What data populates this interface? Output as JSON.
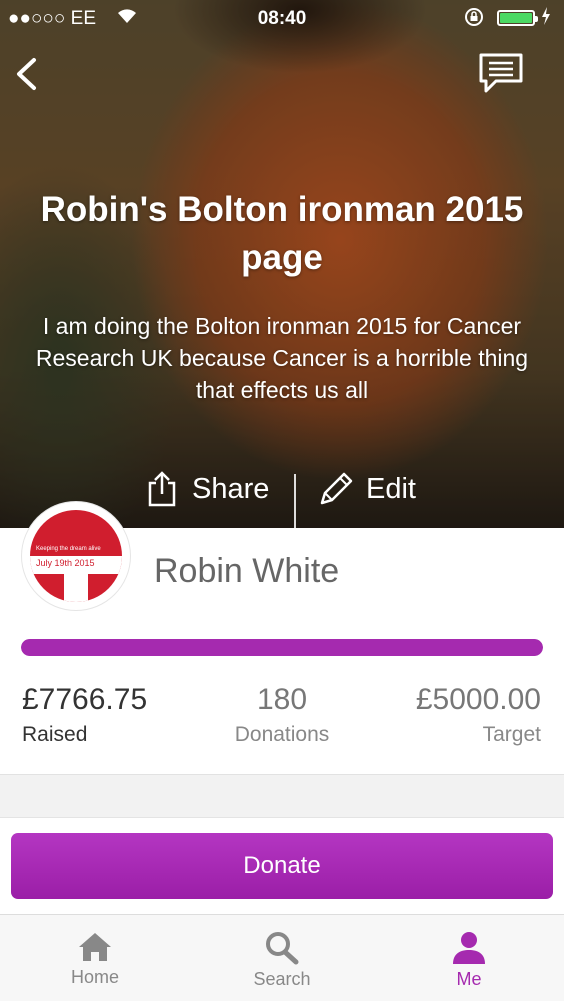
{
  "status_bar": {
    "carrier": "●●○○○ EE",
    "time": "08:40"
  },
  "page": {
    "title": "Robin's Bolton ironman 2015 page",
    "description": "I am doing the Bolton ironman 2015 for Cancer Research UK because Cancer is a horrible thing that effects us all",
    "share_label": "Share",
    "edit_label": "Edit"
  },
  "avatar": {
    "text_top": "Keeping the dream alive",
    "text_date": "July 19th 2015"
  },
  "fundraiser": {
    "name": "Robin White"
  },
  "progress": {
    "fraction": 1.0
  },
  "stats": {
    "raised": {
      "value": "£7766.75",
      "label": "Raised"
    },
    "donations": {
      "value": "180",
      "label": "Donations"
    },
    "target": {
      "value": "£5000.00",
      "label": "Target"
    }
  },
  "donate_label": "Donate",
  "tabs": [
    {
      "label": "Home",
      "icon": "home-icon"
    },
    {
      "label": "Search",
      "icon": "search-icon"
    },
    {
      "label": "Me",
      "icon": "person-icon"
    }
  ],
  "colors": {
    "accent": "#a52aaf",
    "battery": "#4cd964",
    "avatar_red": "#d01e2e"
  }
}
